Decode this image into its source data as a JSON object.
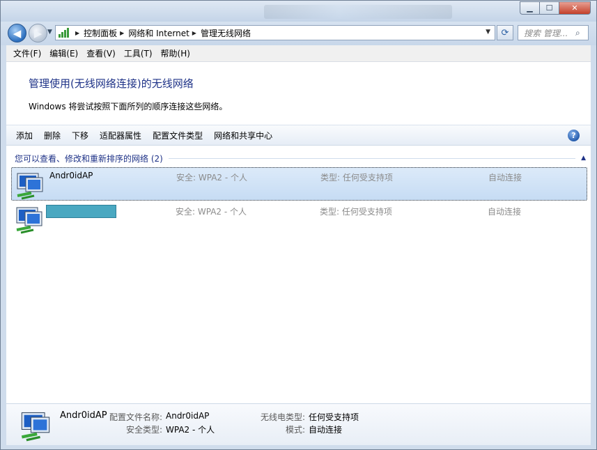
{
  "window": {
    "minimize_glyph": "▁",
    "maximize_glyph": "☐",
    "close_glyph": "✕"
  },
  "address": {
    "breadcrumbs": [
      "控制面板",
      "网络和 Internet",
      "管理无线网络"
    ],
    "search_placeholder": "搜索 管理...",
    "back_glyph": "◀",
    "forward_glyph": "▶",
    "refresh_glyph": "⟳",
    "search_glyph": "⌕"
  },
  "menu": [
    "文件(F)",
    "编辑(E)",
    "查看(V)",
    "工具(T)",
    "帮助(H)"
  ],
  "content": {
    "heading": "管理使用(无线网络连接)的无线网络",
    "subtext": "Windows 将尝试按照下面所列的顺序连接这些网络。"
  },
  "toolbar": {
    "items": [
      "添加",
      "删除",
      "下移",
      "适配器属性",
      "配置文件类型",
      "网络和共享中心"
    ],
    "help_glyph": "?"
  },
  "group": {
    "title": "您可以查看、修改和重新排序的网络 (2)",
    "collapse_glyph": "▲"
  },
  "networks": [
    {
      "name": "Andr0idAP",
      "security": "安全: WPA2 - 个人",
      "type": "类型: 任何受支持项",
      "connect": "自动连接",
      "selected": true,
      "name_redacted": false
    },
    {
      "name": "",
      "security": "安全: WPA2 - 个人",
      "type": "类型: 任何受支持项",
      "connect": "自动连接",
      "selected": false,
      "name_redacted": true
    }
  ],
  "details": {
    "name": "Andr0idAP",
    "profile_label": "配置文件名称:",
    "profile_value": "Andr0idAP",
    "security_label": "安全类型:",
    "security_value": "WPA2 - 个人",
    "radio_label": "无线电类型:",
    "radio_value": "任何受支持项",
    "mode_label": "模式:",
    "mode_value": "自动连接"
  },
  "colors": {
    "heading": "#1e3287",
    "selection": "#c6dcf4",
    "redaction": "#4aa8c1"
  },
  "icons": {
    "network_icon": "wireless-network-icon",
    "control_panel_icon": "network-bars-icon"
  }
}
